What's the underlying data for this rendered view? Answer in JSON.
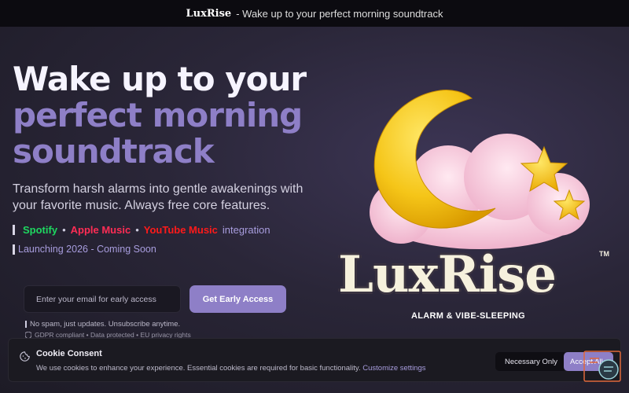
{
  "topbar": {
    "brand": "LuxRise",
    "tagline": "- Wake up to your perfect morning soundtrack"
  },
  "hero": {
    "line1": "Wake up to your",
    "line2": "perfect morning",
    "line3": "soundtrack",
    "lead": "Transform harsh alarms into gentle awakenings with your favorite music. Always free core features.",
    "integrations": {
      "spotify": "Spotify",
      "apple": "Apple Music",
      "youtube": "YouTube Music",
      "suffix": "integration",
      "separator": "•"
    },
    "launch": "Launching 2026 - Coming Soon"
  },
  "signup": {
    "placeholder": "Enter your email for early access",
    "cta": "Get Early Access",
    "note1": "No spam, just updates. Unsubscribe anytime.",
    "note2": "GDPR compliant • Data protected • EU privacy rights"
  },
  "logo": {
    "wordmark": "LuxRise",
    "tm": "TM",
    "tagline": "ALARM & VIBE-SLEEPING"
  },
  "cookie": {
    "title": "Cookie Consent",
    "text": "We use cookies to enhance your experience. Essential cookies are required for basic functionality.",
    "link": "Customize settings",
    "necessary": "Necessary Only",
    "accept": "Accept All"
  },
  "colors": {
    "accent": "#8e7fc7",
    "spotify": "#1ed760",
    "apple": "#ff2d55",
    "youtube": "#ff1a1a",
    "moon": "#f5c518"
  },
  "icons": [
    "cookie-icon",
    "shield-icon",
    "chat-support-icon",
    "moon-icon",
    "star-icon",
    "cloud-icon"
  ]
}
